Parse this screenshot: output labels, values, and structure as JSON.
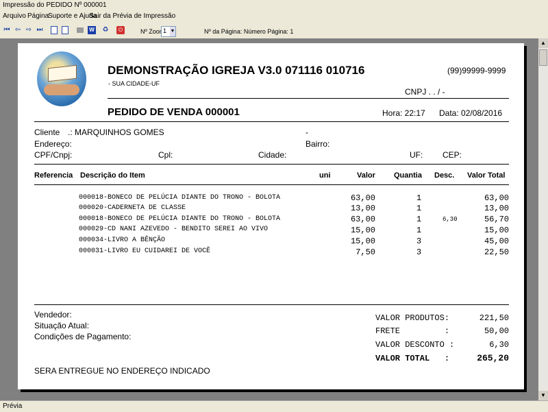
{
  "window": {
    "title": "Impressão do PEDIDO Nº 000001"
  },
  "menu": [
    "Arquivo",
    "Página",
    "Suporte e Ajuda",
    "Sair da Prévia de Impressão"
  ],
  "toolbar": {
    "zoom_label": "Nº Zoom",
    "zoom_value": "1",
    "page_label": "Nº da Página: Número Página: 1"
  },
  "status": "Prévia",
  "doc": {
    "company": "DEMONSTRAÇÃO IGREJA V3.0 071116 010716",
    "city": "- SUA CIDADE-UF",
    "phone": "(99)99999-9999",
    "cnpj": "CNPJ .  .  /   -",
    "order_title": "PEDIDO DE VENDA 000001",
    "hora": "Hora: 22:17",
    "data": "Data: 02/08/2016",
    "client": {
      "cliente_label": "Cliente",
      "cliente_value": ".: MARQUINHOS GOMES",
      "dash": "-",
      "endereco_label": "Endereço:",
      "bairro_label": "Bairro:",
      "cpf_label": "CPF/Cnpj:",
      "cpl_label": "Cpl:",
      "cidade_label": "Cidade:",
      "uf_label": "UF:",
      "cep_label": "CEP:"
    },
    "columns": {
      "ref": "Referencia",
      "desc": "Descrição do Item",
      "uni": "uni",
      "valor": "Valor",
      "quantia": "Quantia",
      "descto": "Desc.",
      "total": "Valor Total"
    },
    "items": [
      {
        "desc": "000018-BONECO DE PELÚCIA DIANTE DO TRONO - BOLOTA",
        "valor": "63,00",
        "qtd": "1",
        "desc_val": "",
        "total": "63,00"
      },
      {
        "desc": "000020-CADERNETA DE CLASSE",
        "valor": "13,00",
        "qtd": "1",
        "desc_val": "",
        "total": "13,00"
      },
      {
        "desc": "000018-BONECO DE PELÚCIA DIANTE DO TRONO - BOLOTA",
        "valor": "63,00",
        "qtd": "1",
        "desc_val": "6,30",
        "total": "56,70"
      },
      {
        "desc": "000029-CD NANI AZEVEDO - BENDITO SEREI AO VIVO",
        "valor": "15,00",
        "qtd": "1",
        "desc_val": "",
        "total": "15,00"
      },
      {
        "desc": "000034-LIVRO A BÊNÇÃO",
        "valor": "15,00",
        "qtd": "3",
        "desc_val": "",
        "total": "45,00"
      },
      {
        "desc": "000031-LIVRO EU CUIDAREI DE VOCÊ",
        "valor": "7,50",
        "qtd": "3",
        "desc_val": "",
        "total": "22,50"
      }
    ],
    "footer": {
      "vendedor": "Vendedor:",
      "situacao": "Situação Atual:",
      "condicoes": "Condições de Pagamento:",
      "entrega": "SERA ENTREGUE NO ENDEREÇO INDICADO"
    },
    "totals": [
      {
        "label": "VALOR PRODUTOS:",
        "value": "221,50"
      },
      {
        "label": "FRETE         :",
        "value": "50,00"
      },
      {
        "label": "VALOR DESCONTO :",
        "value": "6,30"
      },
      {
        "label": "VALOR TOTAL   :",
        "value": "265,20"
      }
    ]
  }
}
